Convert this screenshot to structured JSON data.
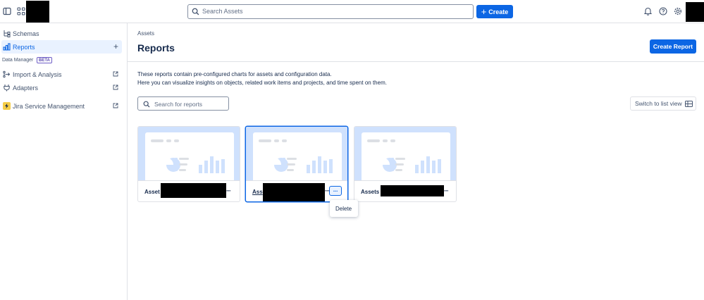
{
  "topbar": {
    "search_placeholder": "Search Assets",
    "create_label": "Create",
    "create_plus": "+"
  },
  "sidebar": {
    "items": [
      {
        "label": "Schemas"
      },
      {
        "label": "Reports",
        "action": "+"
      },
      {
        "label": "Import & Analysis"
      },
      {
        "label": "Adapters"
      },
      {
        "label": "Jira Service Management"
      }
    ],
    "data_manager_label": "Data Manager",
    "beta_badge": "BETA"
  },
  "main": {
    "breadcrumb": "Assets",
    "title": "Reports",
    "create_report_label": "Create Report",
    "description_line1": "These reports contain pre-configured charts for assets and configuration data.",
    "description_line2": "Here you can visualize insights on objects, related work items and projects, and time spent on them.",
    "search_placeholder": "Search for reports",
    "switch_view_label": "Switch to list view"
  },
  "cards": [
    {
      "name": "Asset",
      "dots": "···"
    },
    {
      "name": "Ass",
      "dots": "···",
      "more_icon": "···"
    },
    {
      "name": "Assets",
      "dots": "···"
    }
  ],
  "menu": {
    "delete_label": "Delete"
  },
  "colors": {
    "accent": "#0c66e4",
    "preview_bg": "#cfe1fd",
    "jsm_icon": "#f5cd47"
  }
}
